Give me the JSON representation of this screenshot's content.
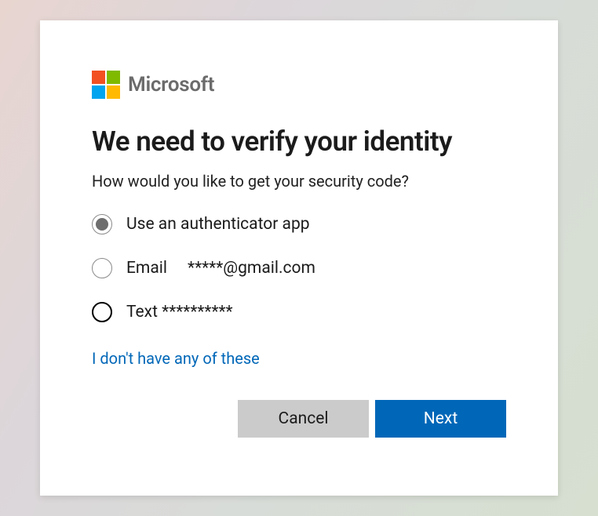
{
  "brand": "Microsoft",
  "title": "We need to verify your identity",
  "subtitle": "How would you like to get your security code?",
  "options": [
    {
      "label": "Use an authenticator app",
      "selected": true,
      "focused": false
    },
    {
      "label": "Email     *****@gmail.com",
      "selected": false,
      "focused": false
    },
    {
      "label": "Text **********",
      "selected": false,
      "focused": true
    }
  ],
  "alt_link": "I don't have any of these",
  "buttons": {
    "cancel": "Cancel",
    "next": "Next"
  },
  "colors": {
    "primary": "#0067b8",
    "cancel_bg": "#cbcbcb"
  }
}
